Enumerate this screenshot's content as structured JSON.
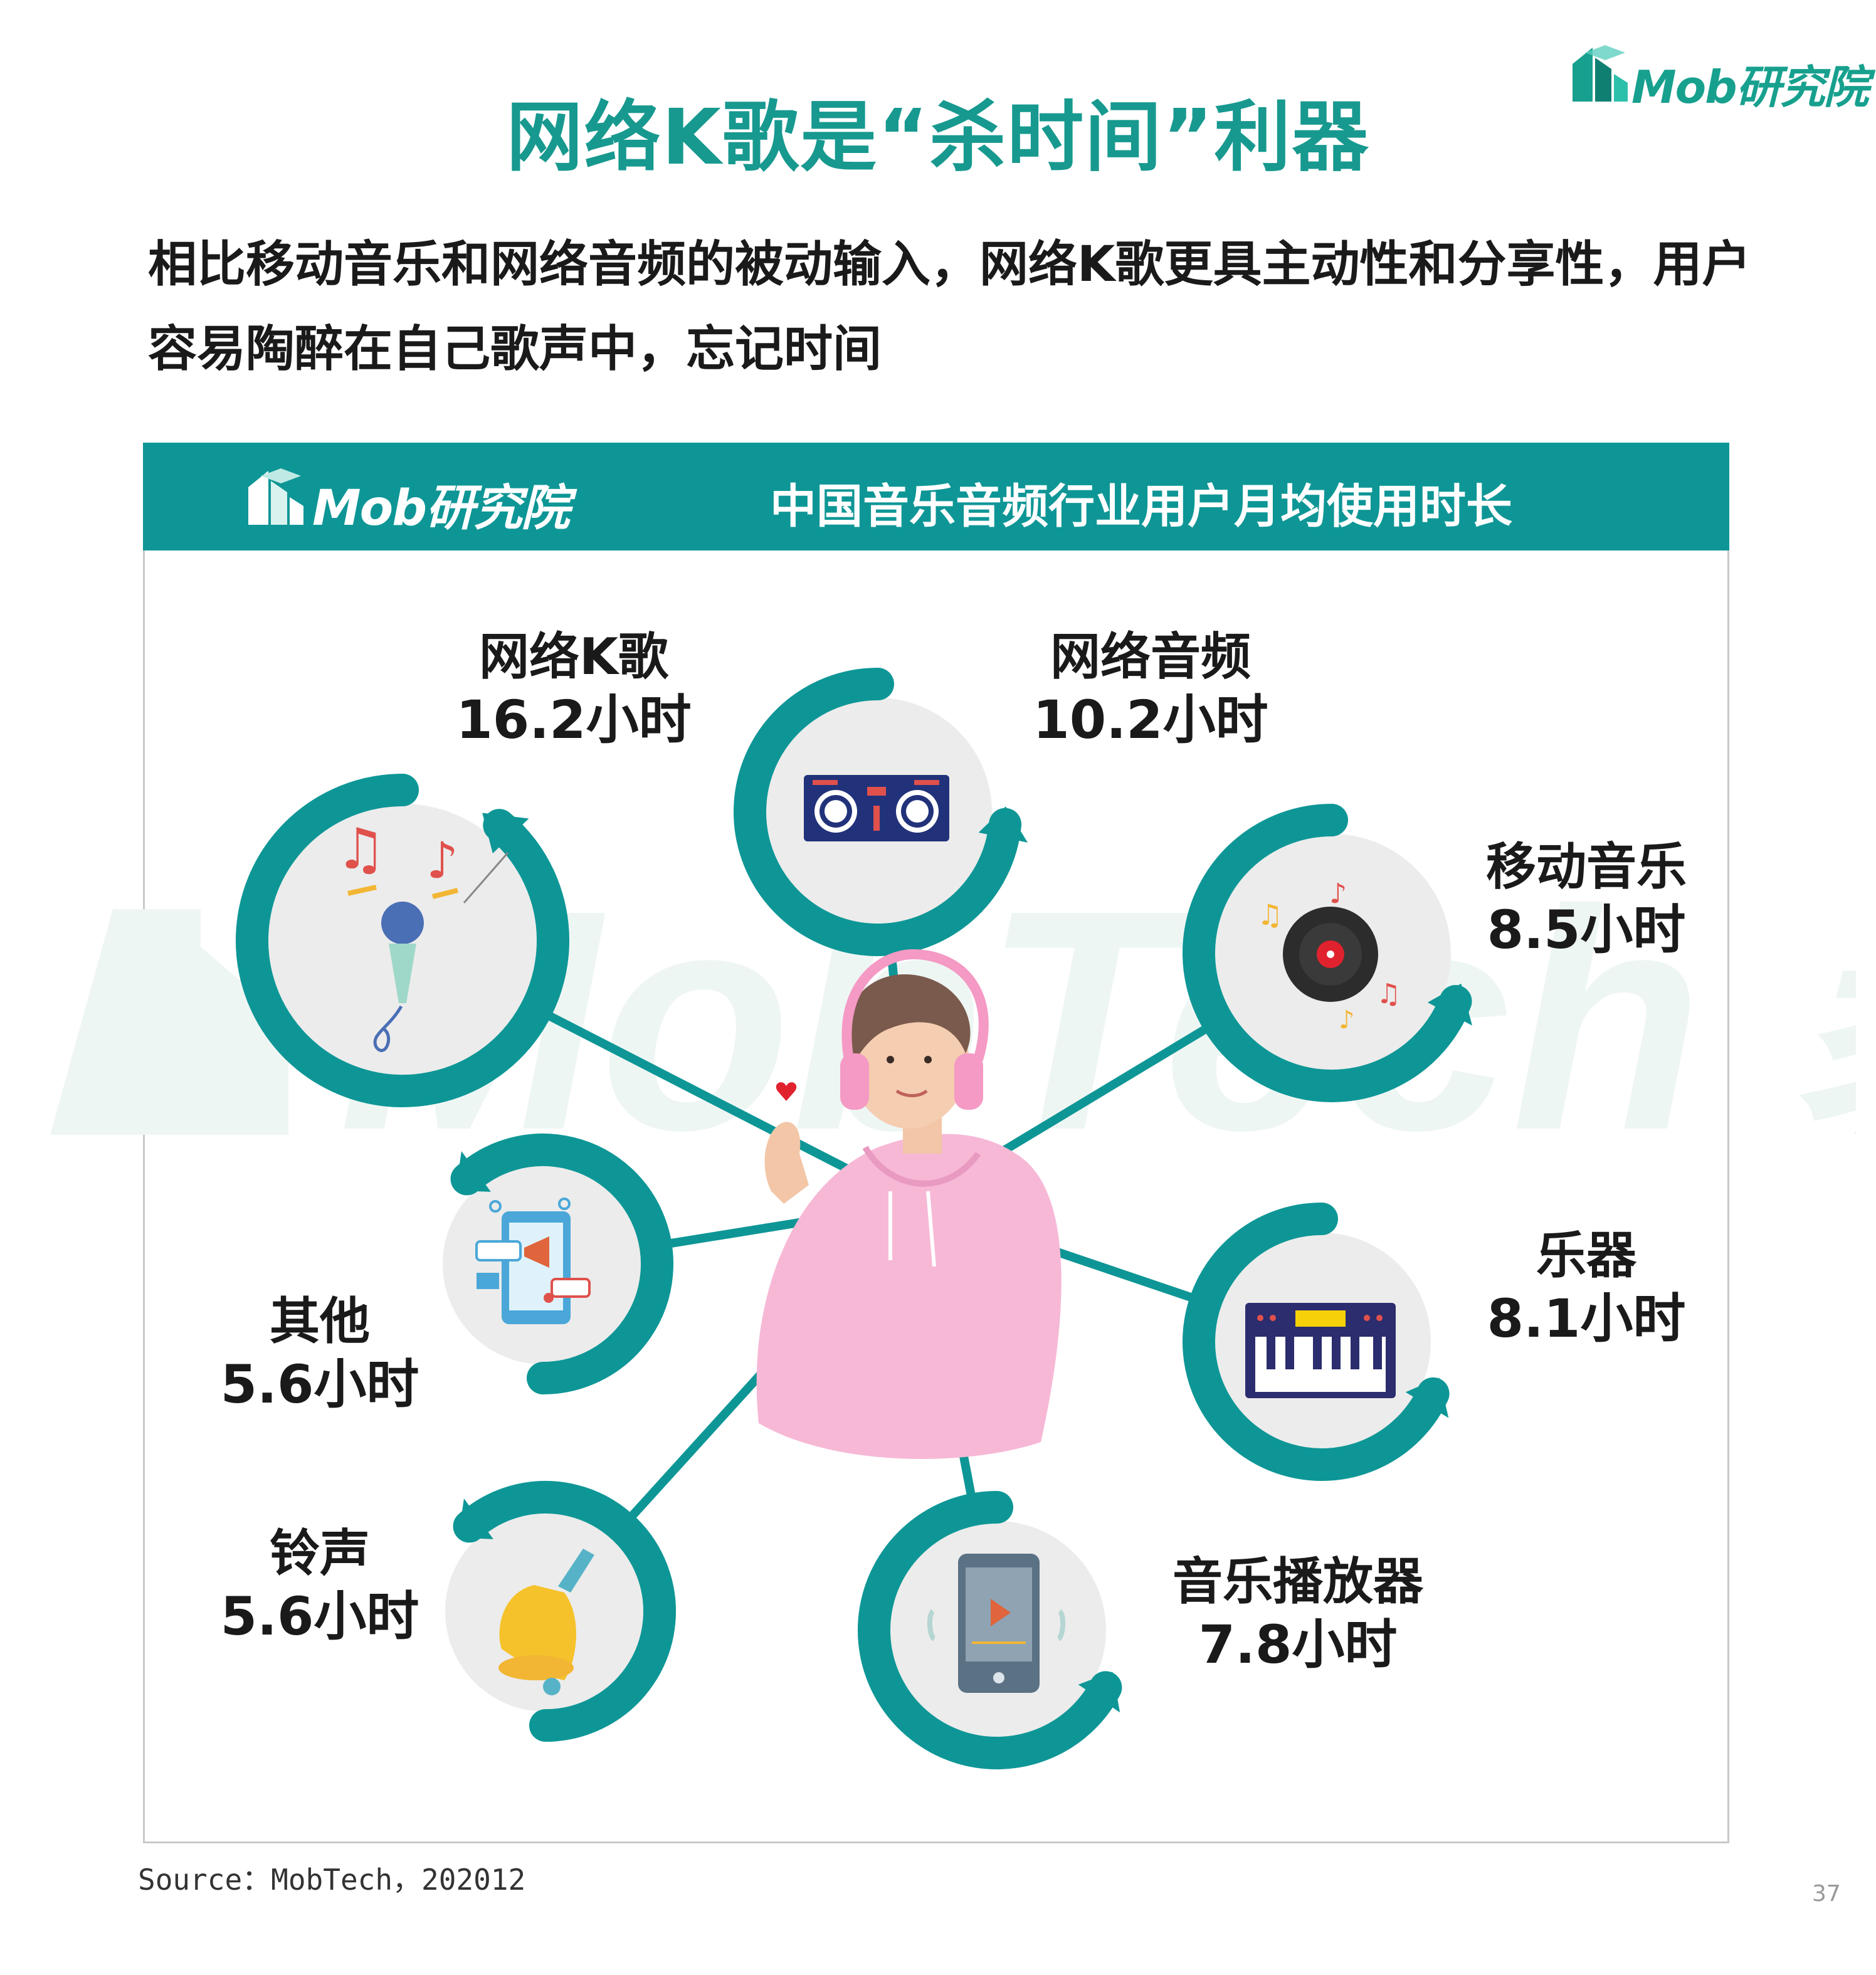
{
  "brand": "Mob研究院",
  "title": "网络K歌是“杀时间”利器",
  "subtitle": "相比移动音乐和网络音频的被动输入，网络K歌更具主动性和分享性，用户容易陶醉在自己歌声中，忘记时间",
  "chart_header": {
    "brand": "Mob研究院",
    "title": "中国音乐音频行业用户月均使用时长"
  },
  "watermark_text": "MobTech 袤博",
  "chart_data": {
    "type": "bubble-network",
    "title": "中国音乐音频行业用户月均使用时长",
    "unit": "小时",
    "categories": [
      "网络K歌",
      "网络音频",
      "移动音乐",
      "乐器",
      "音乐播放器",
      "铃声",
      "其他"
    ],
    "values": [
      16.2,
      10.2,
      8.5,
      8.1,
      7.8,
      5.6,
      5.6
    ],
    "labels": [
      "16.2小时",
      "10.2小时",
      "8.5小时",
      "8.1小时",
      "7.8小时",
      "5.6小时",
      "5.6小时"
    ]
  },
  "icons": [
    "karaoke-microphone-icon",
    "dj-mixer-icon",
    "vinyl-record-icon",
    "keyboard-instrument-icon",
    "music-player-phone-icon",
    "bell-icon",
    "social-media-icon",
    "headphone-person-illustration"
  ],
  "colors": {
    "accent": "#0e9696",
    "title": "#17998f",
    "circle_fill": "#ececec"
  },
  "source": "Source：MobTech，202012",
  "page_number": "37"
}
